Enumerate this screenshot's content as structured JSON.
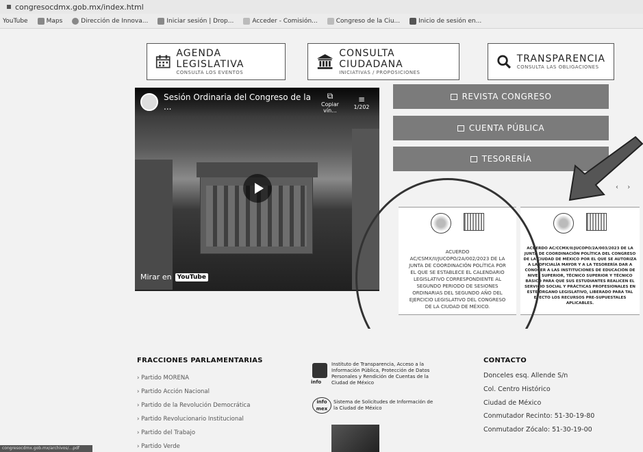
{
  "browser": {
    "url": "congresocdmx.gob.mx/index.html",
    "bookmarks": [
      "YouTube",
      "Maps",
      "Dirección de Innova...",
      "Iniciar sesión | Drop...",
      "Acceder - Comisión...",
      "Congreso de la Ciu...",
      "Inicio de sesión en..."
    ]
  },
  "top_buttons": [
    {
      "label": "AGENDA LEGISLATIVA",
      "sub": "CONSULTA LOS EVENTOS",
      "icon": "calendar-icon"
    },
    {
      "label": "CONSULTA CIUDADANA",
      "sub": "INICIATIVAS / PROPOSICIONES",
      "icon": "building-icon"
    },
    {
      "label": "TRANSPARENCIA",
      "sub": "CONSULTA LAS OBLIGACIONES",
      "icon": "search-icon"
    }
  ],
  "video": {
    "title": "Sesión Ordinaria del Congreso de la ...",
    "copy_label": "Copiar vín...",
    "playlist_count": "1/202",
    "watch_on": "Mirar en",
    "youtube": "YouTube"
  },
  "side_buttons": [
    {
      "label": "REVISTA CONGRESO"
    },
    {
      "label": "CUENTA PÚBLICA"
    },
    {
      "label": "TESORERÍA"
    }
  ],
  "carousel": {
    "prev": "‹",
    "next": "›",
    "cards": [
      {
        "text": "ACUERDO AC/CSMX/II/JUCOPO/2A/002/2023 DE LA JUNTA DE COORDINACIÓN POLÍTICA POR EL QUE SE ESTABLECE EL CALENDARIO LEGISLATIVO CORRESPONDIENTE AL SEGUNDO PERIODO DE SESIONES ORDINARIAS DEL SEGUNDO AÑO DEL EJERCICIO LEGISLATIVO DEL CONGRESO DE LA CIUDAD DE MÉXICO."
      },
      {
        "text": "ACUERDO AC/CCMX/II/JUCOPO/2A/003/2023 DE LA JUNTA DE COORDINACIÓN POLÍTICA DEL CONGRESO DE LA CIUDAD DE MÉXICO POR EL QUE SE AUTORIZA A LA OFICIALÍA MAYOR Y A LA TESORERÍA DAR A CONOCER A LAS INSTITUCIONES DE EDUCACIÓN DE NIVEL SUPERIOR, TÉCNICO SUPERIOR Y TÉCNICO BÁSICO PARA QUE SUS ESTUDIANTES REALICEN EL SERVICIO SOCIAL Y PRÁCTICAS PROFESIONALES EN ESTE ÓRGANO LEGISLATIVO, LIBERADO PARA TAL EFECTO LOS RECURSOS PRE-SUPUESTALES APLICABLES."
      }
    ]
  },
  "footer": {
    "fracciones_title": "FRACCIONES PARLAMENTARIAS",
    "parties": [
      "Partido MORENA",
      "Partido Acción Nacional",
      "Partido de la Revolución Democrática",
      "Partido Revolucionario Institucional",
      "Partido del Trabajo",
      "Partido Verde"
    ],
    "info_inst": "Instituto de Transparencia, Acceso a la Información Pública, Protección de Datos Personales y Rendición de Cuentas de la Ciudad de México",
    "info_logo": "info",
    "infomex_text": "Sistema de Solicitudes de Información de la Ciudad de México",
    "infomex_logo": "info mex",
    "contact_title": "CONTACTO",
    "contact_lines": [
      "Donceles esq. Allende S/n",
      "Col. Centro Histórico",
      "Ciudad de México",
      "Conmutador Recinto: 51-30-19-80",
      "Conmutador Zócalo: 51-30-19-00"
    ]
  },
  "status_bar": "congresocdmx.gob.mx/archivos/...pdf"
}
